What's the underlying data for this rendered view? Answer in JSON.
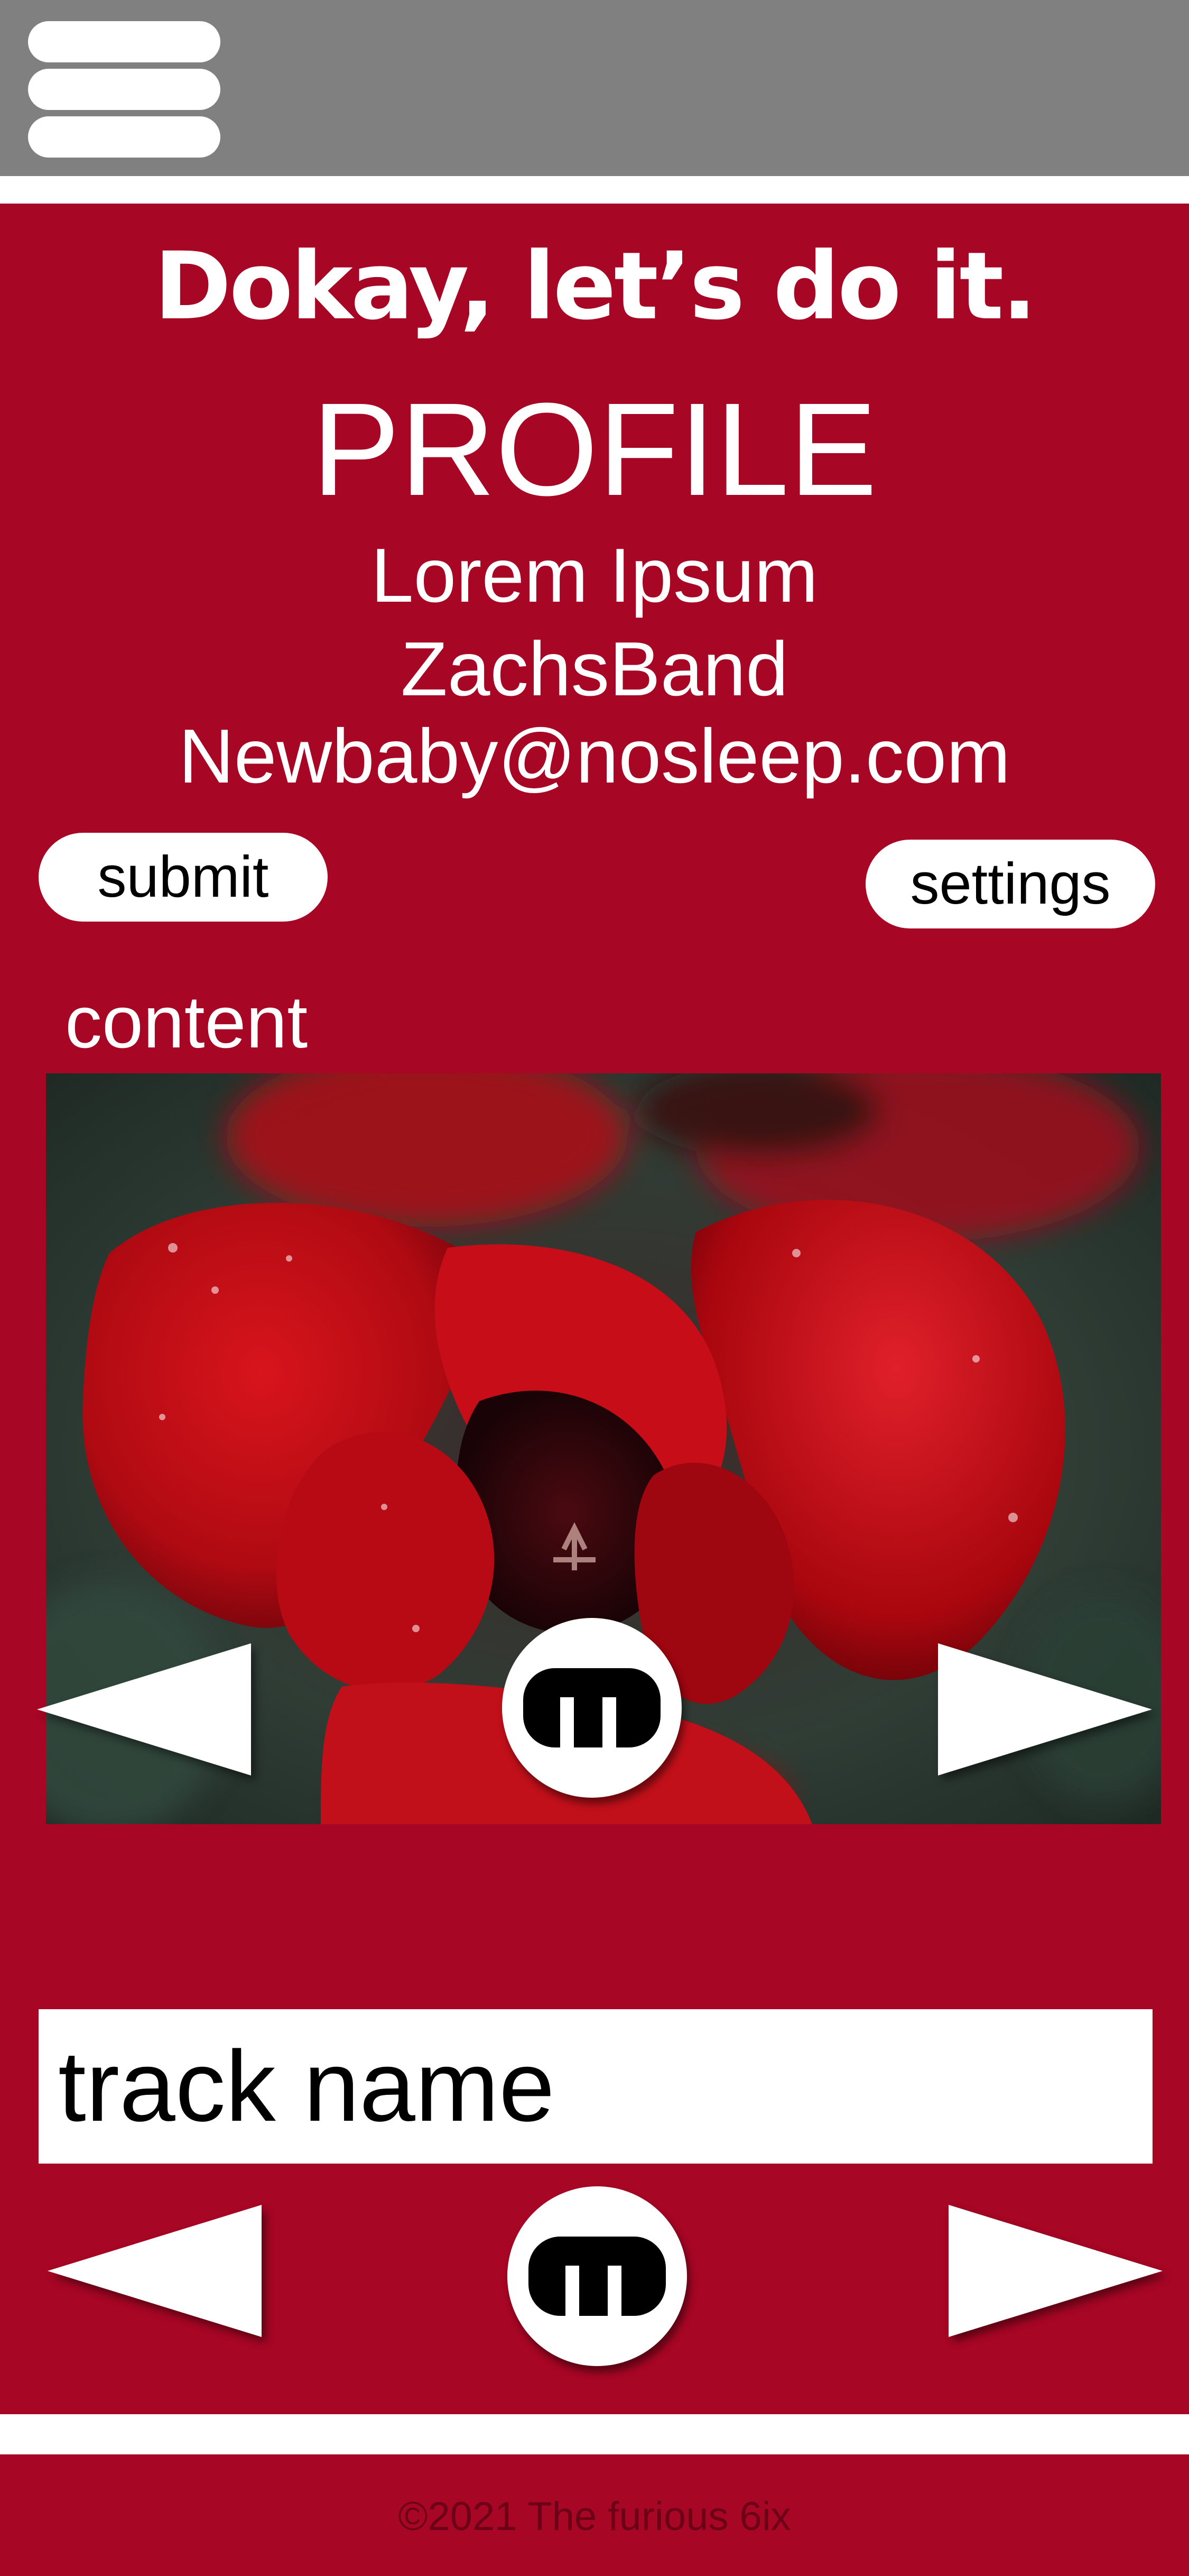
{
  "header": {
    "menu_icon": "hamburger-menu-icon"
  },
  "profile": {
    "slogan": "Dokay, let’s do it.",
    "title": "PROFILE",
    "name": "Lorem Ipsum",
    "band": "ZachsBand",
    "email": "Newbaby@nosleep.com"
  },
  "actions": {
    "submit_label": "submit",
    "settings_label": "settings"
  },
  "content": {
    "label": "content",
    "image": "red-tulip-photo",
    "prev_icon": "left-triangle-icon",
    "next_icon": "right-triangle-icon",
    "center_icon": "m-logo-icon"
  },
  "player": {
    "track_name": "track name",
    "prev_icon": "left-triangle-icon",
    "next_icon": "right-triangle-icon",
    "center_icon": "m-logo-icon"
  },
  "footer": {
    "copyright": "©2021 The furious 6ix"
  },
  "colors": {
    "brand_red": "#a70624",
    "header_gray": "#808080",
    "white": "#ffffff"
  }
}
